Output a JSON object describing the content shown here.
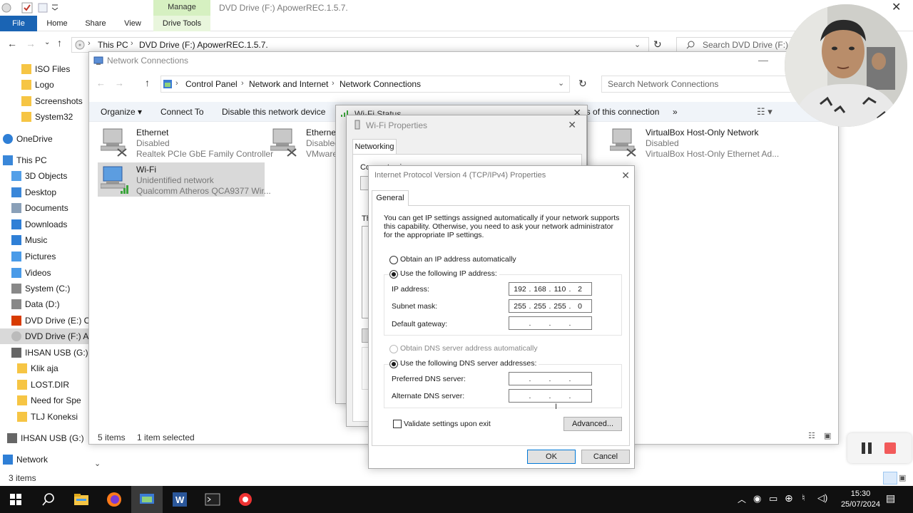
{
  "explorer": {
    "title": "DVD Drive (F:) ApowerREC.1.5.7.",
    "manage_tab": "Manage",
    "tabs": [
      "File",
      "Home",
      "Share",
      "View",
      "Drive Tools"
    ],
    "breadcrumb": [
      "This PC",
      "DVD Drive (F:) ApowerREC.1.5.7."
    ],
    "search_placeholder": "Search DVD Drive (F:) Ap",
    "status_items": "3 items",
    "nav_items": [
      {
        "label": "ISO Files",
        "icon": "folder-icon"
      },
      {
        "label": "Logo",
        "icon": "folder-icon"
      },
      {
        "label": "Screenshots",
        "icon": "folder-icon"
      },
      {
        "label": "System32",
        "icon": "folder-icon"
      },
      {
        "label": "OneDrive",
        "icon": "cloud-icon"
      },
      {
        "label": "This PC",
        "icon": "pc-icon"
      },
      {
        "label": "3D Objects",
        "icon": "cube-icon"
      },
      {
        "label": "Desktop",
        "icon": "desktop-icon"
      },
      {
        "label": "Documents",
        "icon": "documents-icon"
      },
      {
        "label": "Downloads",
        "icon": "download-icon"
      },
      {
        "label": "Music",
        "icon": "music-icon"
      },
      {
        "label": "Pictures",
        "icon": "pictures-icon"
      },
      {
        "label": "Videos",
        "icon": "videos-icon"
      },
      {
        "label": "System (C:)",
        "icon": "drive-icon"
      },
      {
        "label": "Data (D:)",
        "icon": "drive-icon"
      },
      {
        "label": "DVD Drive (E:) O",
        "icon": "office-drive-icon"
      },
      {
        "label": "DVD Drive (F:) A",
        "icon": "dvd-icon"
      },
      {
        "label": "IHSAN USB (G:)",
        "icon": "usb-icon"
      },
      {
        "label": "Klik aja",
        "icon": "folder-icon"
      },
      {
        "label": "LOST.DIR",
        "icon": "folder-icon"
      },
      {
        "label": "Need for Spe",
        "icon": "folder-icon"
      },
      {
        "label": "TLJ Koneksi",
        "icon": "folder-icon"
      },
      {
        "label": "IHSAN USB (G:)",
        "icon": "usb-icon"
      },
      {
        "label": "Network",
        "icon": "network-icon"
      }
    ]
  },
  "network_connections": {
    "title": "Network Connections",
    "breadcrumb": [
      "Control Panel",
      "Network and Internet",
      "Network Connections"
    ],
    "search_placeholder": "Search Network Connections",
    "commands": [
      "Organize",
      "Connect To",
      "Disable this network device",
      "atus of this connection",
      "»"
    ],
    "connections": [
      {
        "name": "Ethernet",
        "status": "Disabled",
        "device": "Realtek PCIe GbE Family Controller"
      },
      {
        "name": "Ethernet",
        "status": "Disabled",
        "device": "VMware"
      },
      {
        "name": "VirtualBox Host-Only Network",
        "status": "Disabled",
        "device": "VirtualBox Host-Only Ethernet Ad..."
      },
      {
        "name": "Wi-Fi",
        "status": "Unidentified network",
        "device": "Qualcomm Atheros QCA9377 Wir..."
      }
    ],
    "status_count": "5 items",
    "status_selected": "1 item selected"
  },
  "wifi_status": {
    "title": "Wi-Fi Status"
  },
  "wifi_properties": {
    "title": "Wi-Fi Properties",
    "tab": "Networking",
    "connect_using": "Connect using:",
    "this_conn": "Th"
  },
  "ipv4": {
    "title": "Internet Protocol Version 4 (TCP/IPv4) Properties",
    "tab": "General",
    "description": "You can get IP settings assigned automatically if your network supports this capability. Otherwise, you need to ask your network administrator for the appropriate IP settings.",
    "obtain_ip_auto": "Obtain an IP address automatically",
    "use_following_ip": "Use the following IP address:",
    "ip_label": "IP address:",
    "subnet_label": "Subnet mask:",
    "gateway_label": "Default gateway:",
    "ip_octets": [
      "192",
      "168",
      "110",
      "2"
    ],
    "subnet_octets": [
      "255",
      "255",
      "255",
      "0"
    ],
    "obtain_dns_auto": "Obtain DNS server address automatically",
    "use_following_dns": "Use the following DNS server addresses:",
    "preferred_dns_label": "Preferred DNS server:",
    "alternate_dns_label": "Alternate DNS server:",
    "validate_label": "Validate settings upon exit",
    "advanced_button": "Advanced...",
    "ok_button": "OK",
    "cancel_button": "Cancel"
  },
  "taskbar": {
    "time": "15:30",
    "date": "25/07/2024"
  }
}
